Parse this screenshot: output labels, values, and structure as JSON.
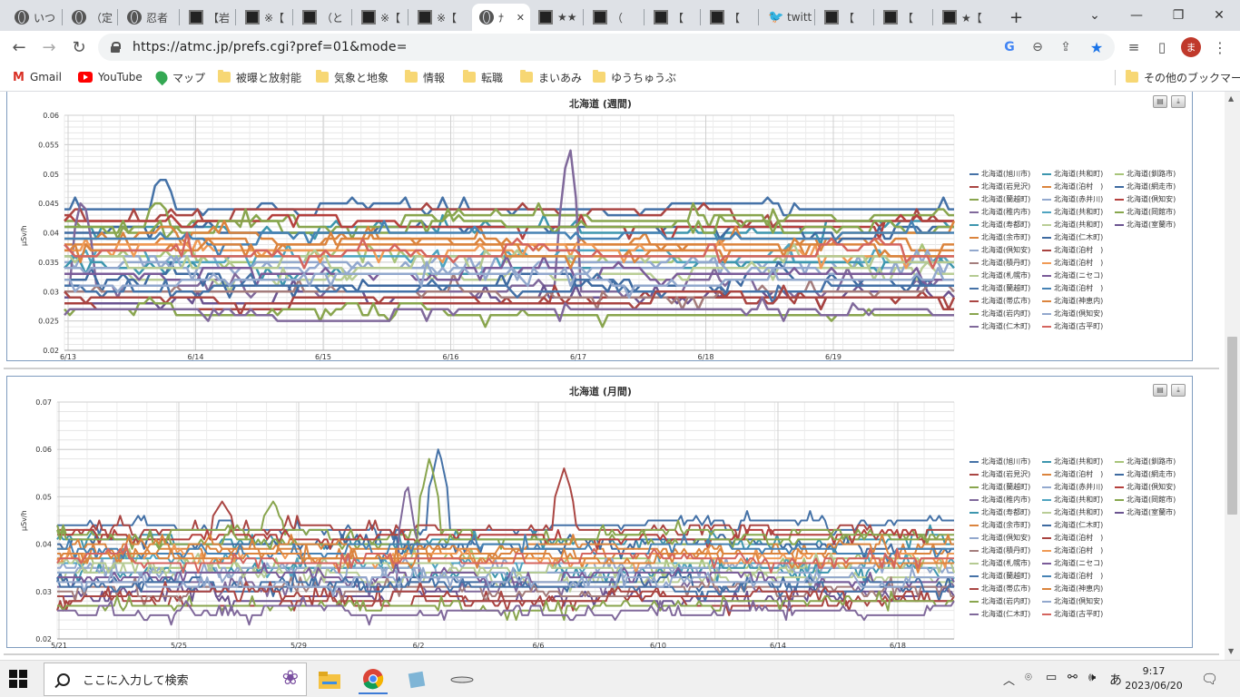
{
  "browser": {
    "tabs": [
      {
        "title": "いつ",
        "icon": "globe-icon"
      },
      {
        "title": "（定",
        "icon": "globe-icon"
      },
      {
        "title": "忍者",
        "icon": "globe-icon"
      },
      {
        "title": "【岩",
        "icon": "site-icon"
      },
      {
        "title": "※【",
        "icon": "site-icon"
      },
      {
        "title": "（と",
        "icon": "site-icon"
      },
      {
        "title": "※【",
        "icon": "site-icon"
      },
      {
        "title": "※【",
        "icon": "site-icon"
      },
      {
        "title": "ﾅ",
        "icon": "globe-icon",
        "active": true
      },
      {
        "title": "★★",
        "icon": "site-icon"
      },
      {
        "title": "（",
        "icon": "site-icon"
      },
      {
        "title": "【",
        "icon": "site-icon"
      },
      {
        "title": "【",
        "icon": "site-icon"
      },
      {
        "title": "twitt",
        "icon": "twitter-icon"
      },
      {
        "title": "【",
        "icon": "site-icon"
      },
      {
        "title": "【",
        "icon": "site-icon"
      },
      {
        "title": "★【",
        "icon": "site-icon"
      }
    ],
    "url": "https://atmc.jp/prefs.cgi?pref=01&mode=",
    "profile_initial": "ま",
    "bookmarks": [
      "Gmail",
      "YouTube",
      "マップ",
      "被曝と放射能",
      "気象と地象",
      "情報",
      "転職",
      "まいあみ",
      "ゆうちゅうぶ"
    ],
    "other_bookmarks": "その他のブックマーク"
  },
  "legend_names": [
    "北海道(旭川市)",
    "北海道(共和町)",
    "北海道(釧路市)",
    "北海道(岩見沢)",
    "北海道(泊村　)",
    "北海道(網走市)",
    "北海道(蘭越町)",
    "北海道(赤井川)",
    "北海道(倶知安)",
    "北海道(稚内市)",
    "北海道(共和町)",
    "北海道(岡館市)",
    "北海道(寿都町)",
    "北海道(共和町)",
    "北海道(室蘭市)",
    "北海道(余市町)",
    "北海道(仁木町)",
    "北海道(倶知安)",
    "北海道(泊村　)",
    "北海道(積丹町)",
    "北海道(泊村　)",
    "北海道(札幌市)",
    "北海道(ニセコ)",
    "北海道(蘭越町)",
    "北海道(泊村　)",
    "北海道(帯広市)",
    "北海道(神恵内)",
    "北海道(岩内町)",
    "北海道(倶知安)",
    "北海道(仁木町)",
    "北海道(古平町)"
  ],
  "legend_colors": [
    "#4572a7",
    "#3d96ae",
    "#a8c57a",
    "#aa4643",
    "#db843d",
    "#3e6aa0",
    "#89a54e",
    "#93a9cf",
    "#b5403d",
    "#80699b",
    "#4fa4c0",
    "#87a74d",
    "#3d96ae",
    "#b9cd96",
    "#6b5490",
    "#db843d",
    "#3e6aa0",
    "#92a8cd",
    "#a8423f",
    "#a47d7c",
    "#f09a55",
    "#b5ca92",
    "#7a5b98",
    "#4572a7",
    "#4682b4",
    "#aa4643",
    "#db843d",
    "#89a54e",
    "#92a8cd",
    "#80699b",
    "#d4655f"
  ],
  "chart_data": [
    {
      "type": "line",
      "title": "北海道 (週間)",
      "ylabel": "μSv/h",
      "ylim": [
        0.02,
        0.06
      ],
      "yticks": [
        "0.06",
        "0.055",
        "0.05",
        "0.045",
        "0.04",
        "0.035",
        "0.03",
        "0.025",
        "0.02"
      ],
      "xticks": [
        "6/13",
        "6/14",
        "6/15",
        "6/16",
        "6/17",
        "6/18",
        "6/19"
      ],
      "grid": true,
      "legend": "right",
      "series_count": 31,
      "base_levels": [
        0.044,
        0.041,
        0.036,
        0.043,
        0.038,
        0.04,
        0.042,
        0.035,
        0.042,
        0.031,
        0.036,
        0.041,
        0.034,
        0.033,
        0.029,
        0.039,
        0.032,
        0.034,
        0.028,
        0.03,
        0.037,
        0.035,
        0.033,
        0.031,
        0.039,
        0.029,
        0.037,
        0.027,
        0.032,
        0.026,
        0.037
      ],
      "peaks": [
        {
          "series": 0,
          "x": 0.11,
          "value": 0.05
        },
        {
          "series": 9,
          "x": 0.567,
          "value": 0.056
        },
        {
          "series": 9,
          "x": 0.02,
          "value": 0.047
        },
        {
          "series": 6,
          "x": 0.105,
          "value": 0.046
        }
      ]
    },
    {
      "type": "line",
      "title": "北海道 (月間)",
      "ylabel": "μSv/h",
      "ylim": [
        0.02,
        0.07
      ],
      "yticks": [
        "0.07",
        "0.06",
        "0.05",
        "0.04",
        "0.03",
        "0.02"
      ],
      "xticks": [
        "5/21",
        "5/25",
        "5/29",
        "6/2",
        "6/6",
        "6/10",
        "6/14",
        "6/18"
      ],
      "grid": true,
      "legend": "right",
      "series_count": 31,
      "base_levels": [
        0.044,
        0.041,
        0.036,
        0.043,
        0.038,
        0.04,
        0.042,
        0.035,
        0.042,
        0.031,
        0.036,
        0.041,
        0.034,
        0.033,
        0.029,
        0.039,
        0.032,
        0.034,
        0.028,
        0.03,
        0.037,
        0.035,
        0.033,
        0.031,
        0.039,
        0.029,
        0.037,
        0.027,
        0.032,
        0.026,
        0.037
      ],
      "peaks": [
        {
          "series": 0,
          "x": 0.425,
          "value": 0.06
        },
        {
          "series": 6,
          "x": 0.415,
          "value": 0.058
        },
        {
          "series": 3,
          "x": 0.565,
          "value": 0.056
        },
        {
          "series": 9,
          "x": 0.39,
          "value": 0.053
        },
        {
          "series": 3,
          "x": 0.185,
          "value": 0.049
        },
        {
          "series": 6,
          "x": 0.24,
          "value": 0.049
        }
      ]
    }
  ],
  "taskbar": {
    "search_placeholder": "ここに入力して検索",
    "time": "9:17",
    "date": "2023/06/20",
    "ime": "あ"
  }
}
